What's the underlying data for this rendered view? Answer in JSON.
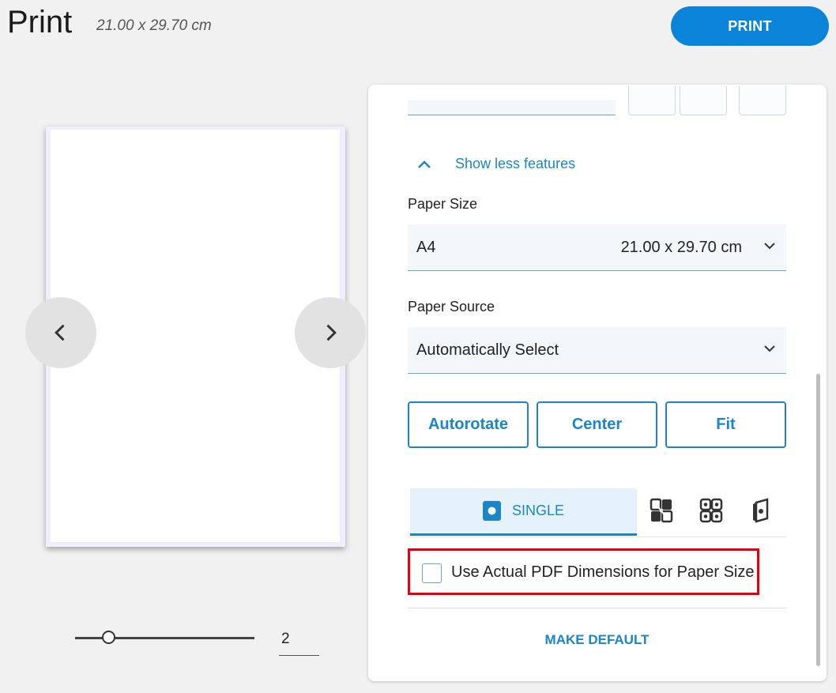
{
  "header": {
    "title": "Print",
    "subtitle": "21.00 x 29.70 cm",
    "print_button": "PRINT"
  },
  "preview": {
    "page_number": "2"
  },
  "panel": {
    "show_less_label": "Show less features",
    "paper_size": {
      "label": "Paper Size",
      "value": "A4",
      "dimensions": "21.00 x 29.70 cm"
    },
    "paper_source": {
      "label": "Paper Source",
      "value": "Automatically Select"
    },
    "buttons": {
      "autorotate": "Autorotate",
      "center": "Center",
      "fit": "Fit"
    },
    "layout_tabs": {
      "single": "SINGLE",
      "icons": [
        "pages-2-icon",
        "pages-4-icon",
        "booklet-icon"
      ]
    },
    "use_actual_pdf_dimensions": {
      "label": "Use Actual PDF Dimensions for Paper Size",
      "checked": false
    },
    "make_default": "MAKE DEFAULT"
  },
  "colors": {
    "accent": "#1a86c8",
    "print_button": "#0a84d8",
    "highlight_border": "#e60012"
  }
}
